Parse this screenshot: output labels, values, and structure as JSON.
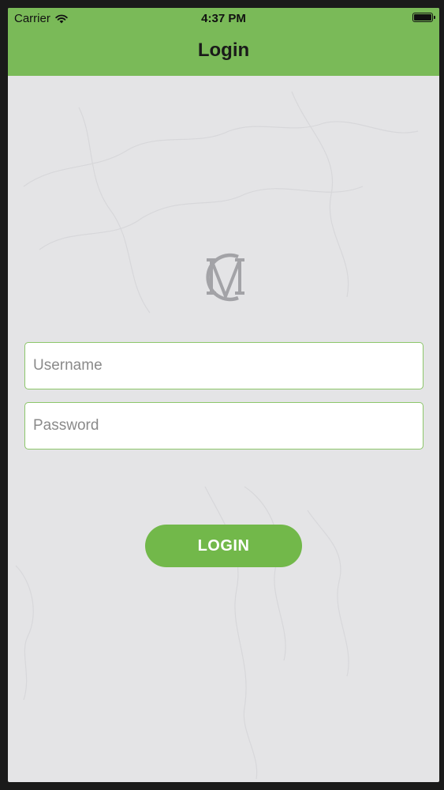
{
  "status_bar": {
    "carrier": "Carrier",
    "time": "4:37 PM",
    "wifi_icon": "wifi-icon",
    "battery_icon": "battery-icon"
  },
  "nav": {
    "title": "Login"
  },
  "logo": {
    "icon": "monogram-logo-icon"
  },
  "form": {
    "username_placeholder": "Username",
    "username_value": "",
    "password_placeholder": "Password",
    "password_value": ""
  },
  "actions": {
    "login_label": "LOGIN"
  },
  "colors": {
    "header_green": "#7aba58",
    "button_green": "#72b84a",
    "field_border": "#8cc66a",
    "background": "#e4e4e6"
  }
}
